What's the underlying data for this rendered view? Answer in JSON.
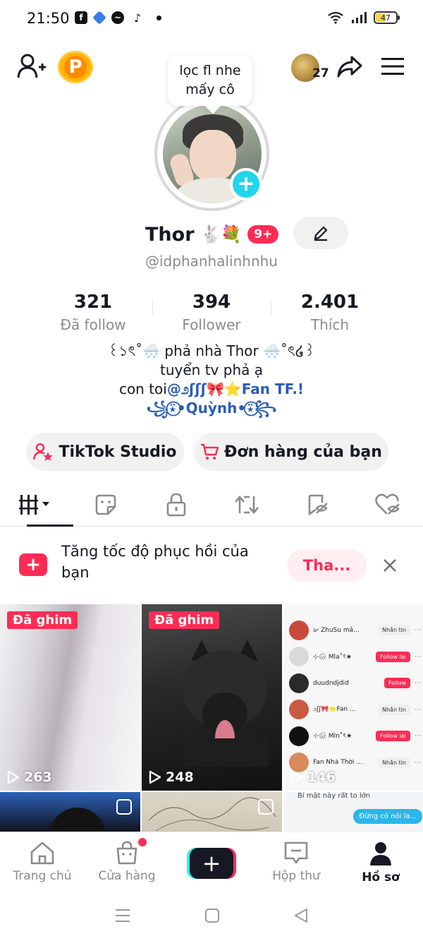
{
  "status_bar": {
    "time": "21:50",
    "battery": "47"
  },
  "header": {
    "coin_label": "P",
    "friends_count": "27",
    "note": "lọc fl nhe mấy cô"
  },
  "profile": {
    "display_name": "Thor",
    "name_emoji": "🐇💐",
    "notif_badge": "9+",
    "username": "@idphanhalinhnhu"
  },
  "stats": [
    {
      "value": "321",
      "label": "Đã follow"
    },
    {
      "value": "394",
      "label": "Follower"
    },
    {
      "value": "2.401",
      "label": "Thích"
    }
  ],
  "bio": {
    "line1": "꒰১ৎ˚🌨️ phả nhà Thor 🌨️˚ৎ໒꒱",
    "line2": "tuyển tv phả ạ",
    "line3_prefix": "con toi",
    "line3_mention": "@೨ʃʃʃ🎀⭐Fan TF.!",
    "line4": "꧁⍣⃝•Quỳnh•⍣⃝꧂"
  },
  "actions": {
    "studio_label": "TikTok Studio",
    "orders_label": "Đơn hàng của bạn"
  },
  "promo": {
    "text": "Tăng tốc độ phục hồi của bạn",
    "button_label": "Tha..."
  },
  "videos": [
    {
      "pinned_label": "Đã ghim",
      "views": "263"
    },
    {
      "pinned_label": "Đã ghim",
      "views": "248"
    },
    {
      "views": "146"
    }
  ],
  "chat_preview": {
    "rows": [
      {
        "name": "ঌ৽ ZhuSu mã...",
        "action": "Nhắn tin"
      },
      {
        "name": "⊹🌨 Mla˚ৎ★",
        "action": "Follow lại"
      },
      {
        "name": "duudndjdid",
        "action": "Follow"
      },
      {
        "name": "೨ʃʃ🎀⭐Fan ...",
        "action": "Nhắn tin"
      },
      {
        "name": "⊹🌨 Mln˚ৎ★",
        "action": "Follow lại"
      },
      {
        "name": "Fan Nhà Thời ...",
        "action": "Nhắn tin"
      }
    ],
    "footer_text": "Bí mật này rất to lớn",
    "bubble_text": "Đừng có nói la..."
  },
  "bottom_nav": [
    {
      "label": "Trang chủ"
    },
    {
      "label": "Cửa hàng"
    },
    {
      "label": "+"
    },
    {
      "label": "Hộp thư"
    },
    {
      "label": "Hồ sơ"
    }
  ],
  "colors": {
    "accent": "#fe2c55",
    "cyan": "#20d5ec",
    "mention": "#2b5db9"
  }
}
